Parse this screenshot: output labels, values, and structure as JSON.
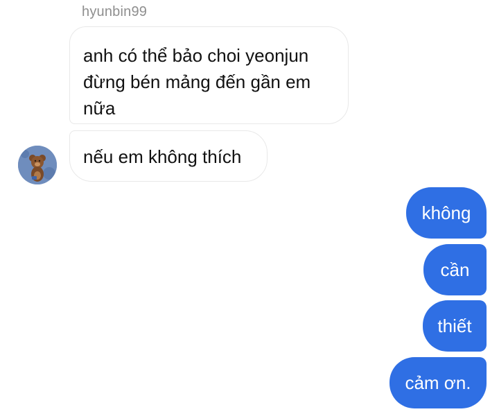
{
  "conversation": {
    "sender_name": "hyunbin99",
    "incoming": [
      {
        "text": "anh có thể bảo choi yeonjun đừng bén mảng đến gần em nữa"
      },
      {
        "text": "nếu em không thích"
      }
    ],
    "outgoing": [
      {
        "text": "không"
      },
      {
        "text": "cần"
      },
      {
        "text": "thiết"
      },
      {
        "text": "cảm ơn."
      }
    ]
  },
  "avatar": {
    "icon": "bear-avatar-icon"
  },
  "colors": {
    "outgoing_bubble": "#2f6fe4",
    "incoming_border": "#e8e8e8",
    "sender_name": "#8e8e8e",
    "background": "#ffffff"
  }
}
